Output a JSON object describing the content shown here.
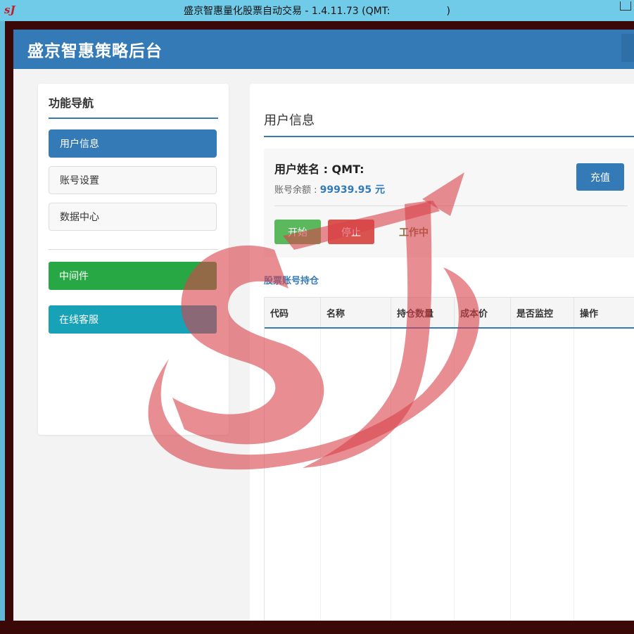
{
  "window": {
    "logo_text": "sJ",
    "title": "盛京智惠量化股票自动交易 - 1.4.11.73 (QMT:                  )"
  },
  "header": {
    "brand": "盛京智惠策略后台"
  },
  "sidebar": {
    "title": "功能导航",
    "items": [
      {
        "label": "用户信息"
      },
      {
        "label": "账号设置"
      },
      {
        "label": "数据中心"
      }
    ],
    "middleware_label": "中间件",
    "support_label": "在线客服"
  },
  "main": {
    "page_title": "用户信息",
    "user": {
      "name_label": "用户姓名 : QMT:",
      "balance_label": "账号余额 :",
      "balance_value": "99939.95 元",
      "recharge_label": "充值"
    },
    "controls": {
      "start_label": "开始",
      "stop_label": "停止",
      "status_text": "工作中"
    },
    "holdings": {
      "title": "股票账号持仓",
      "columns": [
        "代码",
        "名称",
        "持仓数量",
        "成本价",
        "是否监控",
        "操作"
      ],
      "rows": []
    }
  },
  "colors": {
    "primary": "#337ab7",
    "success": "#5cb85c",
    "danger": "#d9534f",
    "middleware": "#28a745",
    "support": "#17a2b8",
    "watermark": "#d9414a"
  },
  "icons": {
    "app_logo": "sj-logo-icon",
    "watermark": "sj-watermark-logo"
  }
}
